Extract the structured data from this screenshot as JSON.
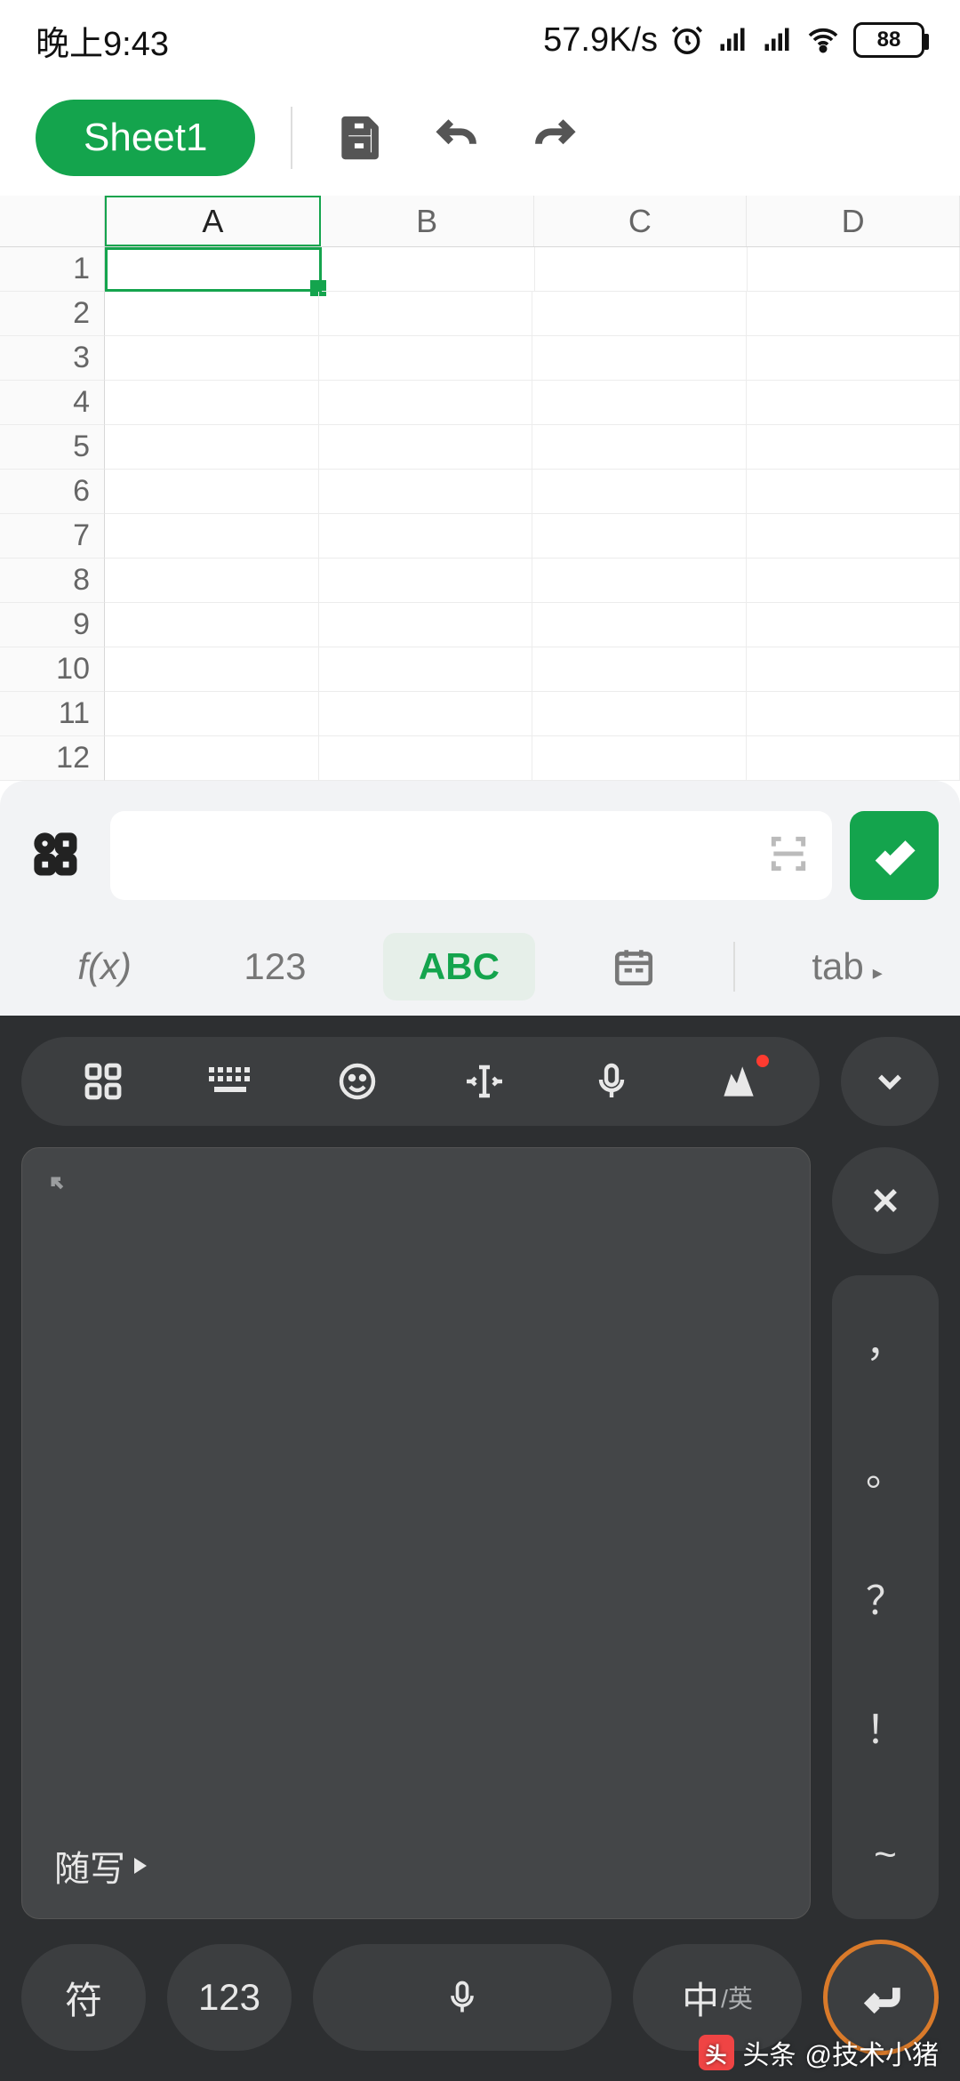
{
  "status": {
    "time": "晚上9:43",
    "net_speed": "57.9K/s",
    "battery": "88"
  },
  "toolbar": {
    "sheet_tab": "Sheet1"
  },
  "sheet": {
    "columns": [
      "A",
      "B",
      "C",
      "D"
    ],
    "rows": [
      "1",
      "2",
      "3",
      "4",
      "5",
      "6",
      "7",
      "8",
      "9",
      "10",
      "11",
      "12"
    ],
    "selected": "A1"
  },
  "formula_bar": {
    "value": "",
    "modes": {
      "fx": "f(x)",
      "num": "123",
      "abc": "ABC",
      "tab": "tab"
    }
  },
  "ime": {
    "handwrite_label": "随写",
    "close": "×",
    "punct": [
      "，",
      "。",
      "？",
      "！",
      "~"
    ],
    "bottom": {
      "symbol": "符",
      "num": "123",
      "lang_main": "中",
      "lang_sub": "/英"
    }
  },
  "footer": {
    "brand": "头条",
    "author": "@技术小猪"
  },
  "colors": {
    "accent": "#14a44d",
    "ime_bg": "#2d2f31",
    "enter_ring": "#d97a2a"
  }
}
